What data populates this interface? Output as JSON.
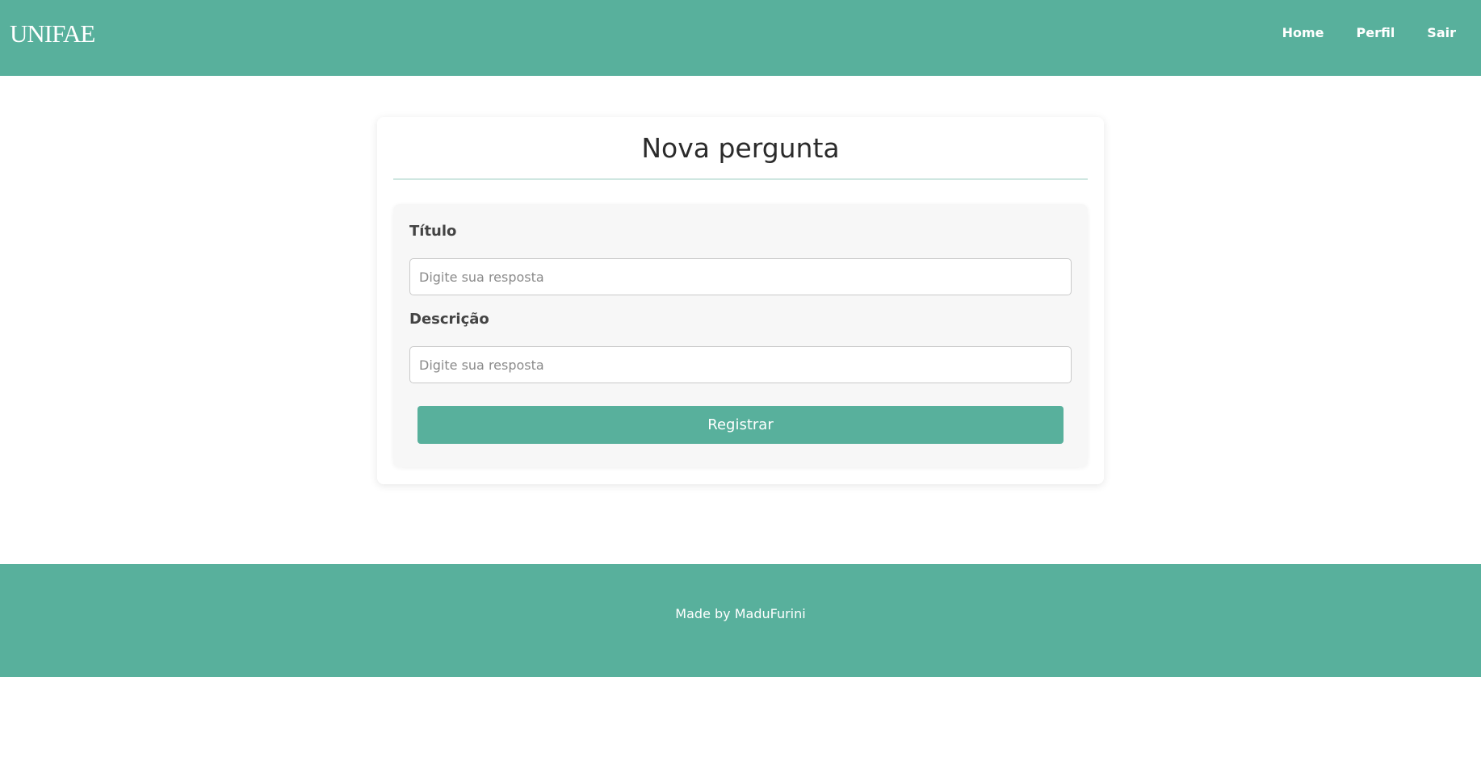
{
  "header": {
    "logo": "UNIFAE",
    "nav": [
      "Home",
      "Perfil",
      "Sair"
    ]
  },
  "form": {
    "title": "Nova pergunta",
    "fields": [
      {
        "label": "Título",
        "placeholder": "Digite sua resposta",
        "value": ""
      },
      {
        "label": "Descrição",
        "placeholder": "Digite sua resposta",
        "value": ""
      }
    ],
    "submit_label": "Registrar"
  },
  "footer": {
    "text": "Made by MaduFurini"
  },
  "colors": {
    "brand": "#58b09c",
    "divider": "#cfe7e1",
    "form_bg": "#f7f7f7"
  }
}
